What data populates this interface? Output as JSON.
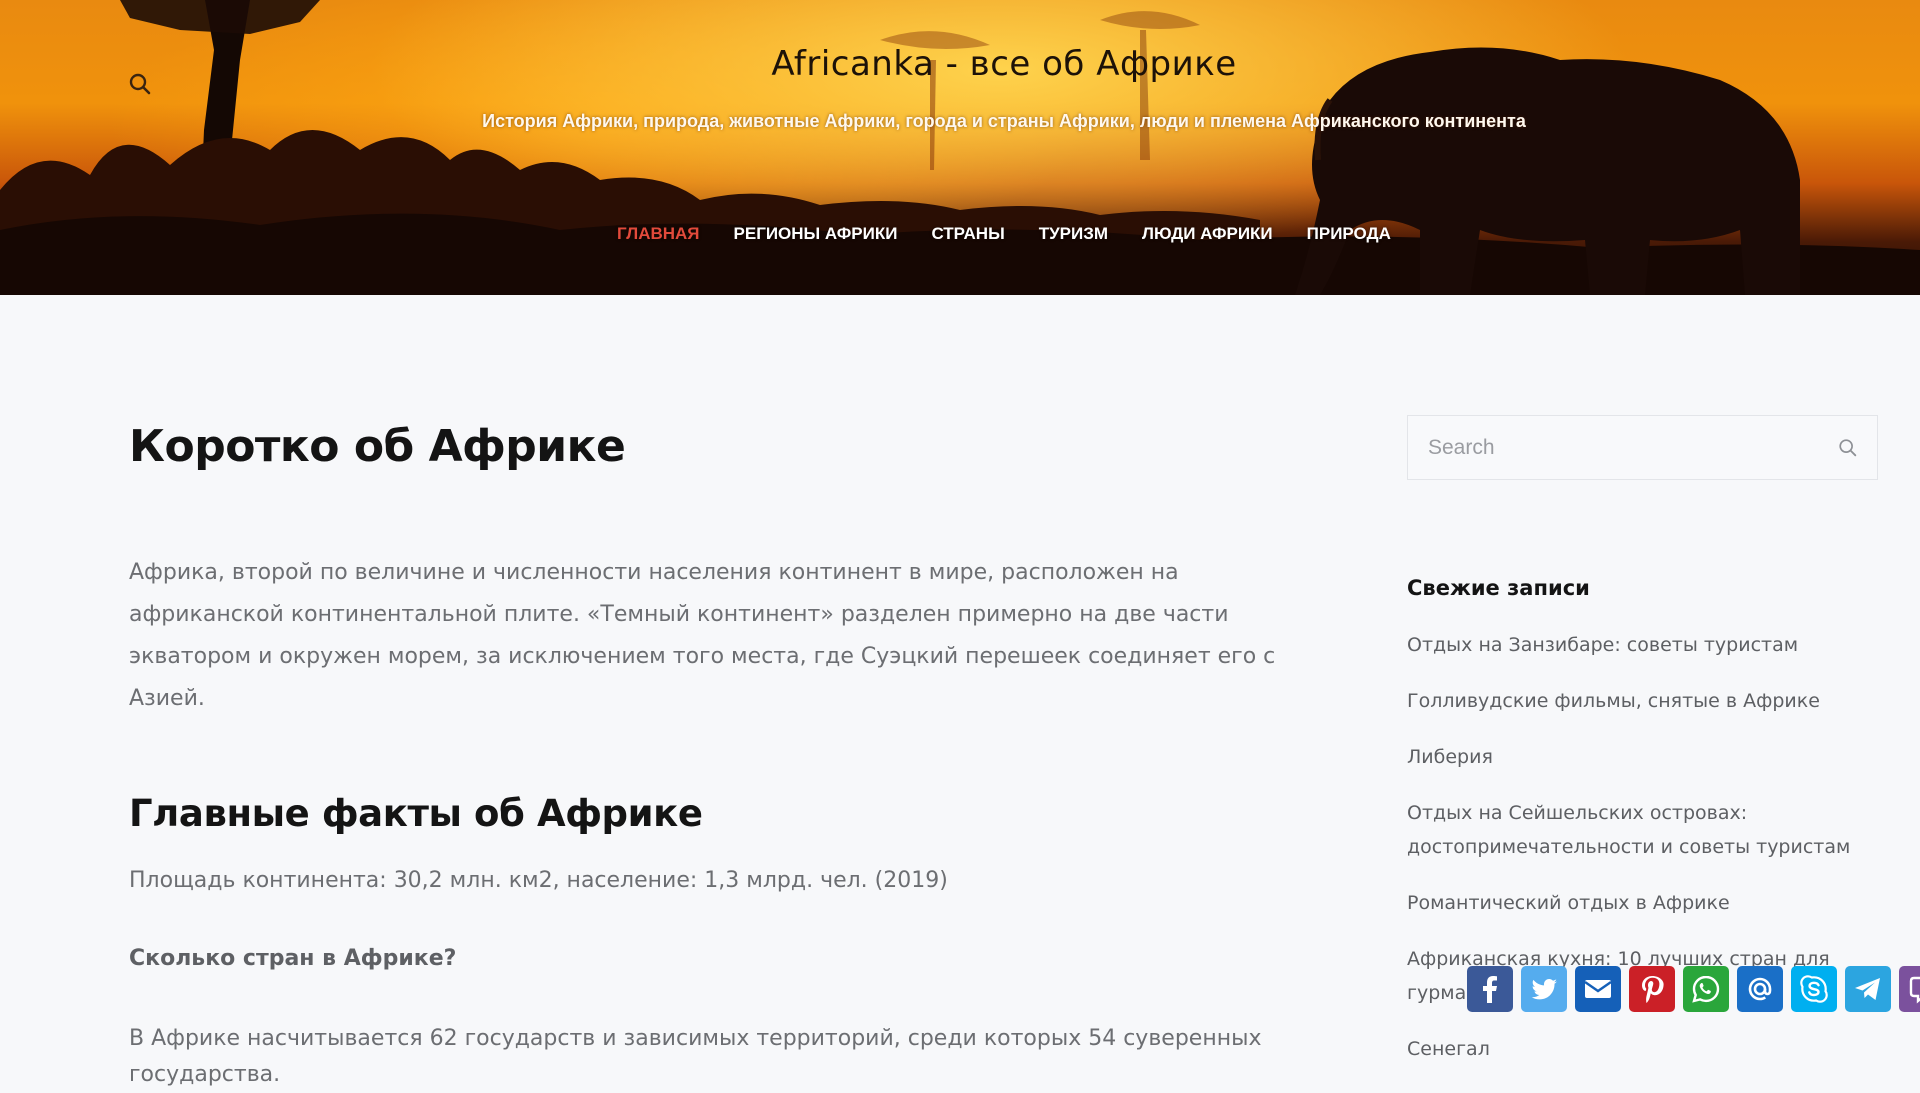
{
  "site": {
    "title": "Africanka - все об Африке",
    "tagline": "История Африки, природа, животные Африки, города и страны Африки, люди и племена Африканского континента"
  },
  "nav": {
    "items": [
      "Главная",
      "Регионы Африки",
      "Страны",
      "Туризм",
      "Люди Африки",
      "Природа"
    ],
    "active": "Главная"
  },
  "article": {
    "title": "Коротко об Африке",
    "intro": "Африка, второй по величине и численности населения континент в мире, расположен на африканской континентальной плите. «Темный континент» разделен примерно на две части экватором и окружен морем, за исключением того места, где Суэцкий перешеек соединяет его с Азией.",
    "h2": "Главные факты об Африке",
    "fact": "Площадь континента: 30,2 млн. км2, население: 1,3 млрд. чел. (2019)",
    "question": "Сколько стран в Африке?",
    "answer": "В Африке насчитывается 62 государств и зависимых территорий, среди которых 54 суверенных государства."
  },
  "sidebar": {
    "search_placeholder": "Search",
    "recent_title": "Свежие записи",
    "recent": [
      "Отдых на Занзибаре: советы туристам",
      "Голливудские фильмы, снятые в Африке",
      "Либерия",
      "Отдых на Сейшельских островах: достопримечательности и советы туристам",
      "Романтический отдых в Африке",
      "Африканская кухня: 10 лучших стран для гурманов",
      "Сенегал"
    ]
  },
  "share": {
    "buttons": [
      {
        "icon": "facebook-icon",
        "color": "#3b5998"
      },
      {
        "icon": "twitter-icon",
        "color": "#55acee"
      },
      {
        "icon": "email-icon",
        "color": "#1560b8"
      },
      {
        "icon": "pinterest-icon",
        "color": "#cb2027"
      },
      {
        "icon": "whatsapp-icon",
        "color": "#2aa63b"
      },
      {
        "icon": "mailru-icon",
        "color": "#1a6fc7"
      },
      {
        "icon": "skype-icon",
        "color": "#00aff0"
      },
      {
        "icon": "telegram-icon",
        "color": "#2ca5e0"
      },
      {
        "icon": "viber-icon",
        "color": "#7b519d"
      }
    ]
  },
  "colors": {
    "accent": "#e24a3b",
    "background": "#f7f8fa",
    "heading": "#141414",
    "body_text": "#6c6e72"
  }
}
